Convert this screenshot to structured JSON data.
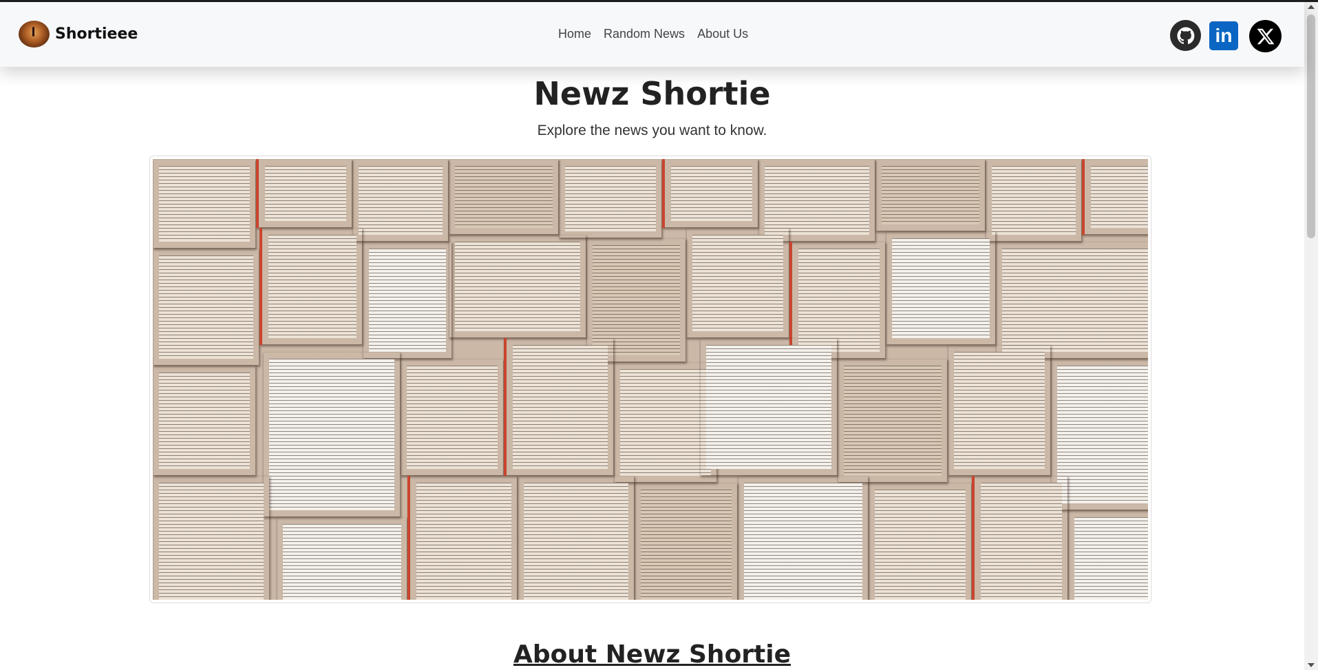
{
  "navbar": {
    "brand_name": "Shortieee",
    "brand_logo_icon": "fire-lamp-logo-icon",
    "links": [
      "Home",
      "Random News",
      "About Us"
    ],
    "social": [
      {
        "name": "github-icon",
        "glyph": "🐱"
      },
      {
        "name": "linkedin-icon",
        "glyph": "in"
      },
      {
        "name": "x-twitter-icon",
        "glyph": "𝕏"
      }
    ]
  },
  "hero": {
    "title": "Newz Shortie",
    "subtitle": "Explore the news you want to know.",
    "image_icon": "open-books-collage-image"
  },
  "about": {
    "heading": "About Newz Shortie"
  },
  "colors": {
    "navbar_bg": "#f7f8fa",
    "linkedin": "#0a66c2",
    "github": "#2b2b2b",
    "x": "#000000"
  }
}
